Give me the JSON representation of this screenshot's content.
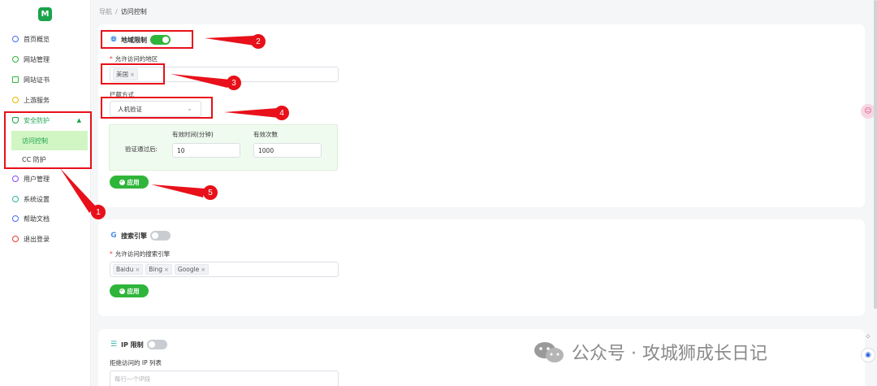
{
  "app": {
    "logo_letter": "M"
  },
  "breadcrumb": {
    "root": "导航",
    "separator": "/",
    "current": "访问控制"
  },
  "sidebar": {
    "items": [
      {
        "label": "首页概览",
        "icon": "dashboard-icon"
      },
      {
        "label": "网站管理",
        "icon": "globe-icon"
      },
      {
        "label": "网站证书",
        "icon": "certificate-icon"
      },
      {
        "label": "上游服务",
        "icon": "upstream-icon"
      },
      {
        "label": "安全防护",
        "icon": "shield-icon",
        "expanded": true
      },
      {
        "label": "用户管理",
        "icon": "user-icon"
      },
      {
        "label": "系统设置",
        "icon": "gear-icon"
      },
      {
        "label": "帮助文档",
        "icon": "help-icon"
      },
      {
        "label": "退出登录",
        "icon": "logout-icon"
      }
    ],
    "sub_items": [
      {
        "label": "访问控制",
        "current": true
      },
      {
        "label": "CC 防护",
        "current": false
      }
    ]
  },
  "geo": {
    "title": "地域限制",
    "enabled": true,
    "allowed_label": "允许访问的地区",
    "allowed_tags": [
      "美国"
    ],
    "block_label": "拦截方式",
    "block_value": "人机验证",
    "verify_label": "验证通过后:",
    "duration_label": "有效时间(分钟)",
    "duration_value": "10",
    "count_label": "有效次数",
    "count_value": "1000",
    "apply_label": "应用"
  },
  "search_engine": {
    "title": "搜索引擎",
    "enabled": false,
    "allowed_label": "允许访问的搜索引擎",
    "tags": [
      "Baidu",
      "Bing",
      "Google"
    ],
    "apply_label": "应用"
  },
  "ip_limit": {
    "title": "IP 限制",
    "enabled": false,
    "deny_label": "拒绝访问的 IP 列表",
    "placeholder": "每行一个IP段"
  },
  "callouts": [
    "1",
    "2",
    "3",
    "4",
    "5"
  ],
  "watermark": {
    "text": "公众号 · 攻城狮成长日记"
  },
  "colors": {
    "accent": "#2fb53a",
    "annotation": "#e8101a"
  }
}
